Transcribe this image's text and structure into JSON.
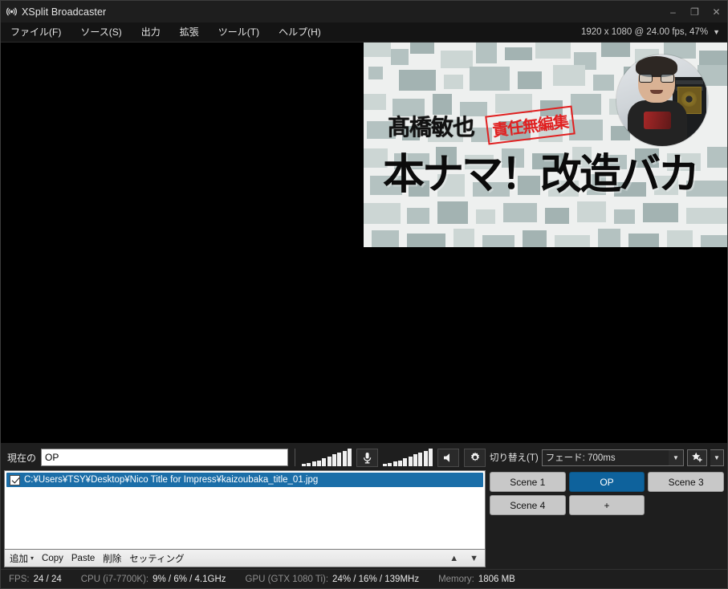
{
  "window": {
    "title": "XSplit Broadcaster",
    "app_icon": "broadcast-waves-icon",
    "minimize": "–",
    "maximize": "❐",
    "close": "✕"
  },
  "menubar": {
    "items": [
      {
        "label": "ファイル(F)",
        "name": "menu-file"
      },
      {
        "label": "ソース(S)",
        "name": "menu-sources"
      },
      {
        "label": "出力",
        "name": "menu-output"
      },
      {
        "label": "拡張",
        "name": "menu-extensions"
      },
      {
        "label": "ツール(T)",
        "name": "menu-tools"
      },
      {
        "label": "ヘルプ(H)",
        "name": "menu-help"
      }
    ],
    "resolution_info": "1920 x 1080 @ 24.00 fps, 47%",
    "resolution_caret": "▼"
  },
  "preview": {
    "title_name": "髙橋敏也",
    "stamp_text": "責任無編集",
    "main_title": "本ナマ！改造バカ",
    "stamp_color": "#e02020",
    "background_style": "digital-camouflage"
  },
  "sources_panel": {
    "current_label": "現在の",
    "current_value": "OP",
    "current_placeholder": "",
    "mic_icon": "microphone-icon",
    "speaker_icon": "speaker-icon",
    "settings_icon": "gear-icon",
    "mic_meter_levels": [
      12,
      18,
      26,
      34,
      44,
      55,
      66,
      78,
      88,
      100
    ],
    "speaker_meter_levels": [
      12,
      18,
      26,
      34,
      44,
      55,
      66,
      78,
      88,
      100
    ],
    "items": [
      {
        "checked": true,
        "path": "C:¥Users¥TSY¥Desktop¥Nico Title for Impress¥kaizoubaka_title_01.jpg",
        "selected": true
      }
    ],
    "toolbar": {
      "add_label": "追加",
      "add_caret": "▾",
      "copy_label": "Copy",
      "paste_label": "Paste",
      "delete_label": "削除",
      "settings_label": "セッティング",
      "move_up": "▲",
      "move_down": "▼"
    }
  },
  "scenes_panel": {
    "transition_label": "切り替え(T)",
    "transition_value": "フェード: 700ms",
    "transition_caret": "▼",
    "star_icon": "star-plus-icon",
    "star_caret": "▼",
    "active_color": "#0e629c",
    "buttons": [
      {
        "label": "Scene 1",
        "active": false
      },
      {
        "label": "OP",
        "active": true
      },
      {
        "label": "Scene 3",
        "active": false
      },
      {
        "label": "Scene 4",
        "active": false
      },
      {
        "label": "+",
        "active": false
      }
    ]
  },
  "statusbar": {
    "fps_label": "FPS:",
    "fps_value": "24 / 24",
    "cpu_label": "CPU (i7-7700K):",
    "cpu_value": "9% / 6% / 4.1GHz",
    "gpu_label": "GPU (GTX 1080 Ti):",
    "gpu_value": "24% / 16% / 139MHz",
    "memory_label": "Memory:",
    "memory_value": "1806 MB"
  }
}
